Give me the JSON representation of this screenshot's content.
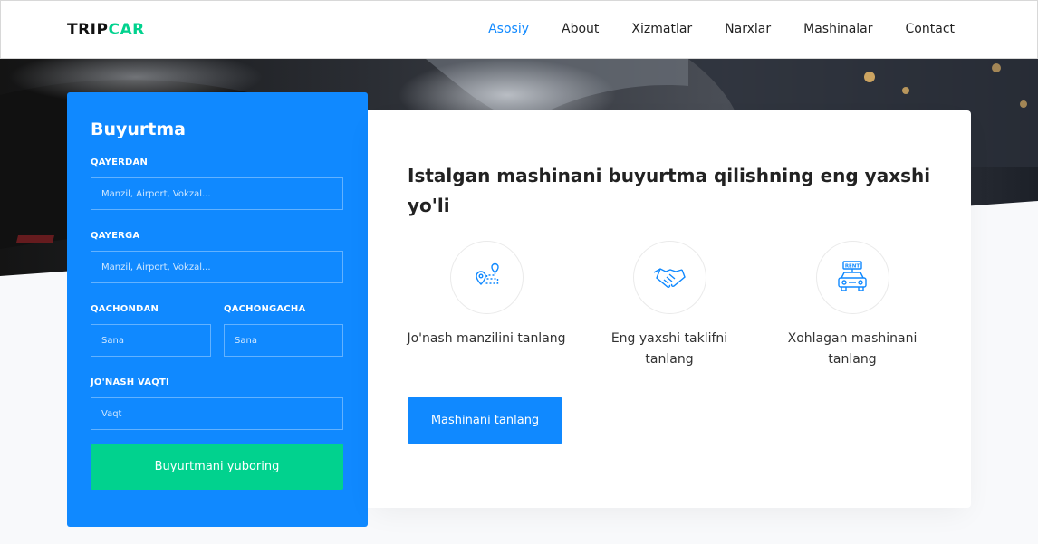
{
  "brand": {
    "part1": "TRIP",
    "part2": "CAR"
  },
  "nav": {
    "items": [
      {
        "label": "Asosiy",
        "active": true
      },
      {
        "label": "About",
        "active": false
      },
      {
        "label": "Xizmatlar",
        "active": false
      },
      {
        "label": "Narxlar",
        "active": false
      },
      {
        "label": "Mashinalar",
        "active": false
      },
      {
        "label": "Contact",
        "active": false
      }
    ]
  },
  "booking": {
    "title": "Buyurtma",
    "from_label": "QAYERDAN",
    "from_placeholder": "Manzil, Airport, Vokzal...",
    "to_label": "QAYERGA",
    "to_placeholder": "Manzil, Airport, Vokzal...",
    "start_label": "QACHONDAN",
    "start_placeholder": "Sana",
    "end_label": "QACHONGACHA",
    "end_placeholder": "Sana",
    "time_label": "JO'NASH VAQTI",
    "time_placeholder": "Vaqt",
    "submit_label": "Buyurtmani yuboring"
  },
  "info": {
    "headline": "Istalgan mashinani buyurtma qilishning eng yaxshi yo'li",
    "features": [
      {
        "icon": "route-icon",
        "label": "Jo'nash manzilini tanlang"
      },
      {
        "icon": "handshake-icon",
        "label": "Eng yaxshi taklifni tanlang"
      },
      {
        "icon": "rent-car-icon",
        "label": "Xohlagan mashinani tanlang"
      }
    ],
    "cta_label": "Mashinani tanlang"
  },
  "colors": {
    "primary": "#1089ff",
    "accent": "#01d28e",
    "text": "#222222"
  }
}
